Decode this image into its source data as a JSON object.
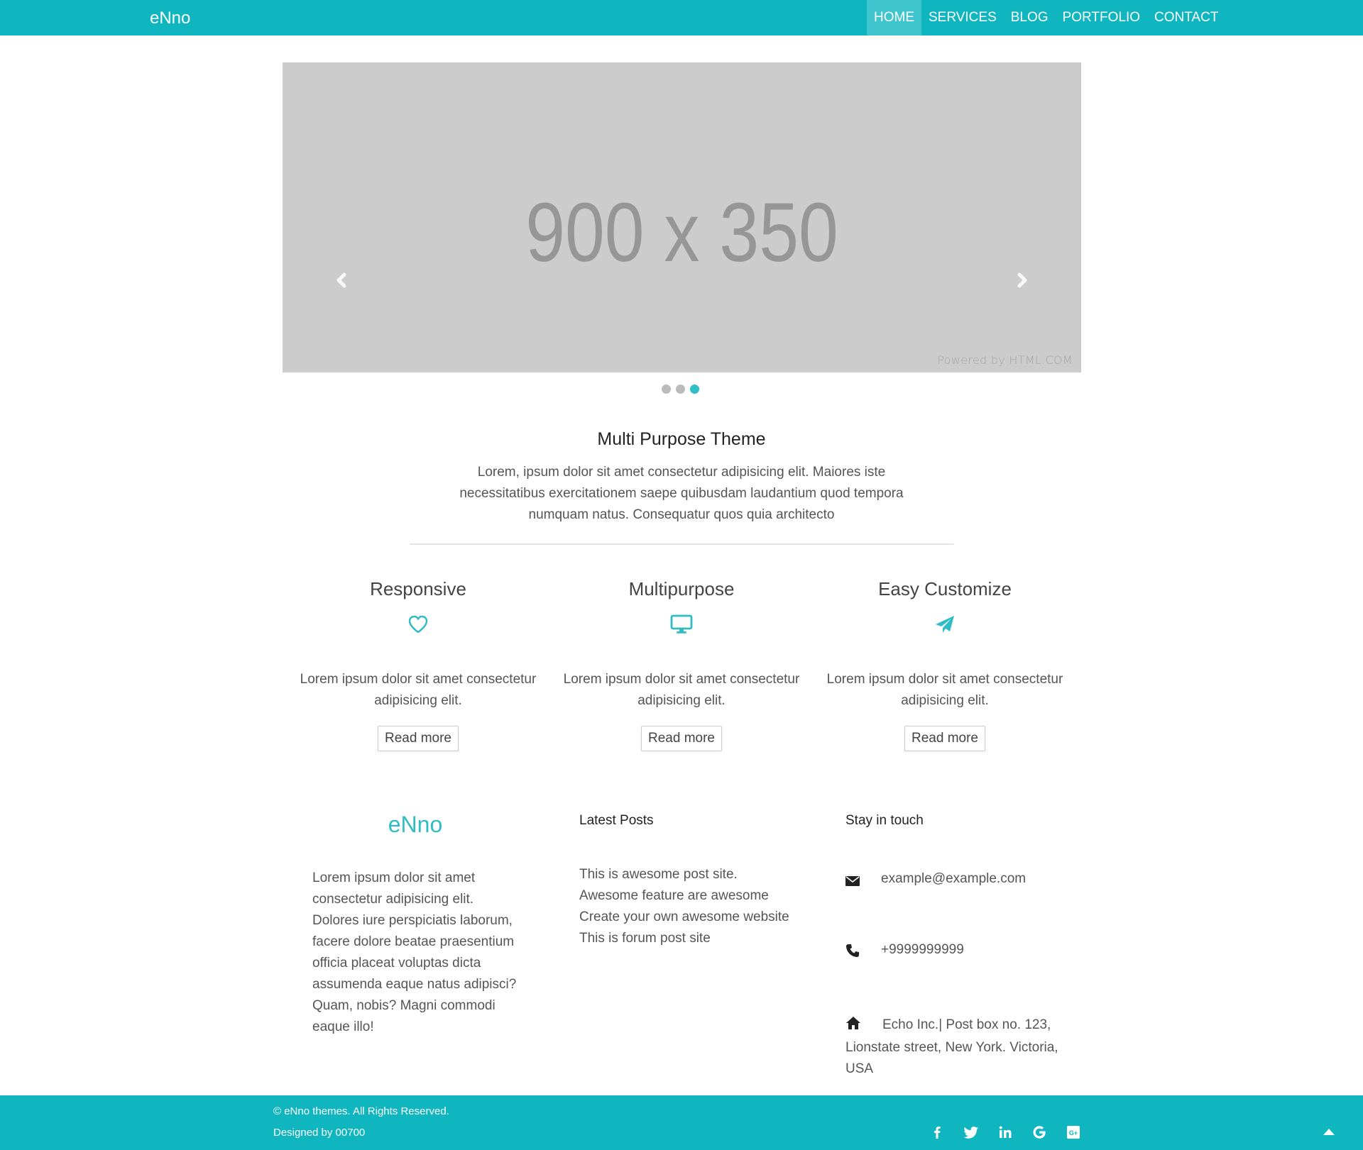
{
  "brand": "eNno",
  "nav": {
    "items": [
      "HOME",
      "SERVICES",
      "BLOG",
      "PORTFOLIO",
      "CONTACT"
    ],
    "active": "HOME"
  },
  "carousel": {
    "placeholder_text": "900 x 350",
    "powered_by": "Powered by HTML.COM",
    "slide_count": 3,
    "active_slide": 3
  },
  "intro": {
    "title": "Multi Purpose Theme",
    "text": "Lorem, ipsum dolor sit amet consectetur adipisicing elit. Maiores iste necessitatibus exercitationem saepe quibusdam laudantium quod tempora numquam natus. Consequatur quos quia architecto"
  },
  "features": [
    {
      "title": "Responsive",
      "icon": "heart-icon",
      "text": "Lorem ipsum dolor sit amet consectetur adipisicing elit.",
      "button": "Read more"
    },
    {
      "title": "Multipurpose",
      "icon": "desktop-icon",
      "text": "Lorem ipsum dolor sit amet consectetur adipisicing elit.",
      "button": "Read more"
    },
    {
      "title": "Easy Customize",
      "icon": "paper-plane-icon",
      "text": "Lorem ipsum dolor sit amet consectetur adipisicing elit.",
      "button": "Read more"
    }
  ],
  "footer_about": {
    "brand": "eNno",
    "text": "Lorem ipsum dolor sit amet consectetur adipisicing elit. Dolores iure perspiciatis laborum, facere dolore beatae praesentium officia placeat voluptas dicta assumenda eaque natus adipisci? Quam, nobis? Magni commodi eaque illo!"
  },
  "latest_posts": {
    "title": "Latest Posts",
    "items": [
      "This is awesome post site.",
      "Awesome feature are awesome",
      "Create your own awesome website",
      "This is forum post site"
    ]
  },
  "contact": {
    "title": "Stay in touch",
    "email": "example@example.com",
    "phone": "+9999999999",
    "address": "Echo Inc.| Post box no. 123, Lionstate street, New York. Victoria, USA"
  },
  "footer": {
    "copyright": "© eNno themes. All Rights Reserved.",
    "designed_by": "Designed by 00700",
    "social_icons": [
      "facebook-icon",
      "twitter-icon",
      "linkedin-icon",
      "google-icon",
      "google-plus-icon"
    ]
  },
  "colors": {
    "accent": "#0fb5bf",
    "accent_light": "#2fbcc6",
    "placeholder_bg": "#cccccc"
  }
}
